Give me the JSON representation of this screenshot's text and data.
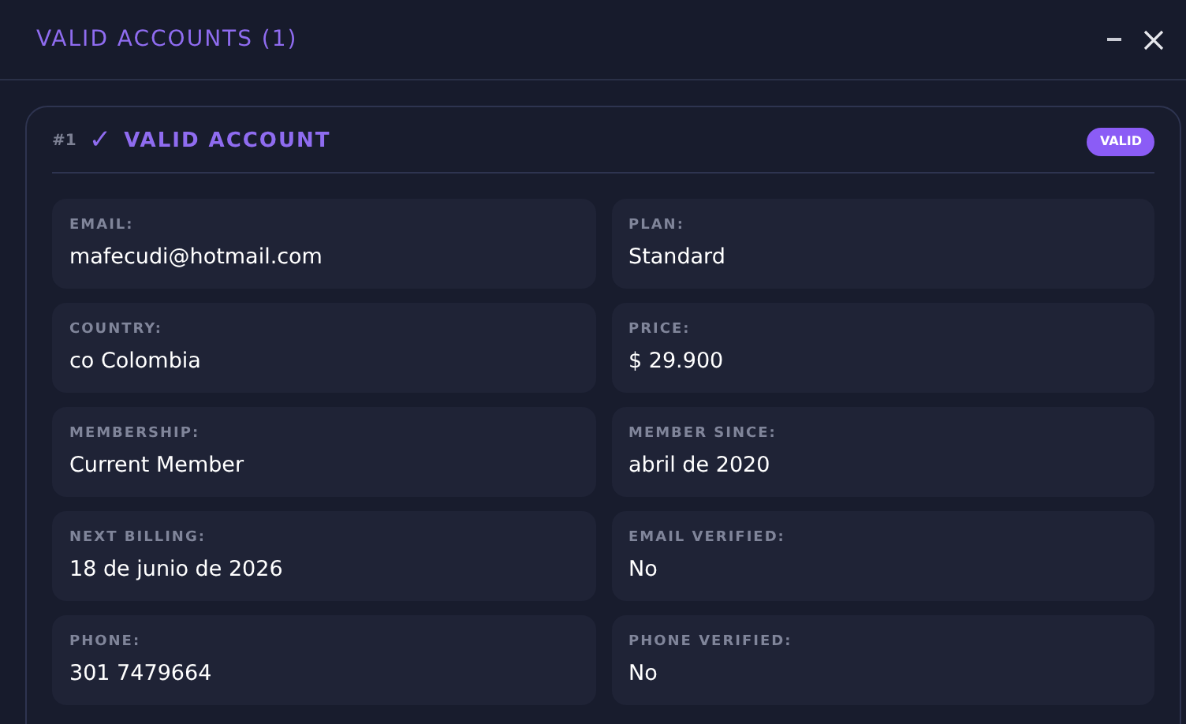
{
  "window": {
    "title": "VALID ACCOUNTS (1)"
  },
  "account": {
    "index": "#1",
    "check": "✓",
    "title": "VALID ACCOUNT",
    "badge": "VALID",
    "fields": [
      {
        "label": "EMAIL:",
        "value": "mafecudi@hotmail.com"
      },
      {
        "label": "PLAN:",
        "value": "Standard"
      },
      {
        "label": "COUNTRY:",
        "value": "co Colombia"
      },
      {
        "label": "PRICE:",
        "value": "$ 29.900"
      },
      {
        "label": "MEMBERSHIP:",
        "value": "Current Member"
      },
      {
        "label": "MEMBER SINCE:",
        "value": "abril de 2020"
      },
      {
        "label": "NEXT BILLING:",
        "value": "18 de junio de 2026"
      },
      {
        "label": "EMAIL VERIFIED:",
        "value": "No"
      },
      {
        "label": "PHONE:",
        "value": "301 7479664"
      },
      {
        "label": "PHONE VERIFIED:",
        "value": "No"
      }
    ]
  }
}
